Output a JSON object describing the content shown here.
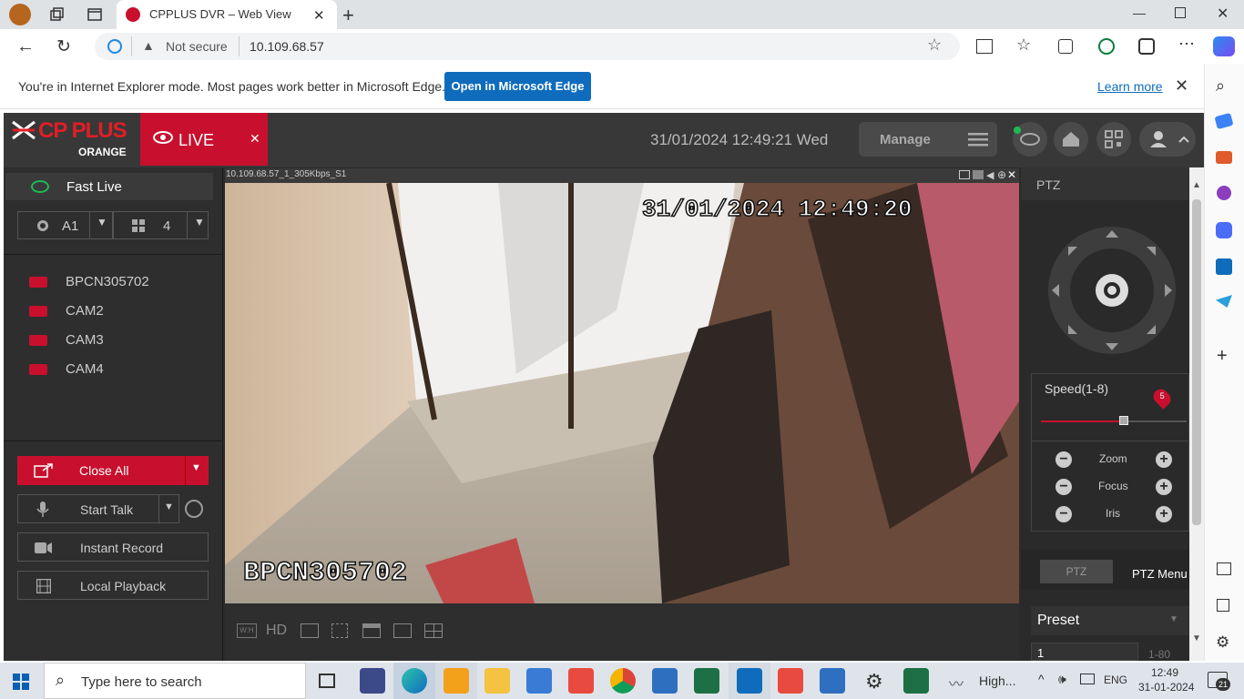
{
  "browser": {
    "tab_title": "CPPLUS DVR – Web View",
    "security_label": "Not secure",
    "url": "10.109.68.57",
    "ie_message": "You're in Internet Explorer mode. Most pages work better in Microsoft Edge.",
    "open_edge_label": "Open in Microsoft Edge",
    "learn_more_label": "Learn more"
  },
  "app": {
    "logo_main": "CP PLUS",
    "logo_sub": "ORANGE",
    "live_label": "LIVE",
    "datetime": "31/01/2024 12:49:21 Wed",
    "manage_label": "Manage"
  },
  "left": {
    "fast_live_label": "Fast Live",
    "stream_select": "A1",
    "layout_select": "4",
    "cameras": [
      "BPCN305702",
      "CAM2",
      "CAM3",
      "CAM4"
    ],
    "close_all_label": "Close All",
    "start_talk_label": "Start Talk",
    "instant_record_label": "Instant Record",
    "local_playback_label": "Local Playback"
  },
  "video": {
    "channel_info": "10.109.68.57_1_305Kbps_S1",
    "osd_time": "31/01/2024 12:49:20",
    "osd_name": "BPCN305702",
    "hd_label": "HD",
    "wh_label": "W:H"
  },
  "ptz": {
    "title": "PTZ",
    "speed_label": "Speed(1-8)",
    "speed_value": "5",
    "speed_fraction": 0.57,
    "zoom_label": "Zoom",
    "focus_label": "Focus",
    "iris_label": "Iris",
    "tab_ptz": "PTZ",
    "tab_menu": "PTZ Menu",
    "preset_label": "Preset",
    "preset_value": "1",
    "preset_range": "1-80"
  },
  "taskbar": {
    "search_placeholder": "Type here to search",
    "weather_text": "High...",
    "lang": "ENG",
    "time": "12:49",
    "date": "31-01-2024",
    "notif_count": "21"
  }
}
